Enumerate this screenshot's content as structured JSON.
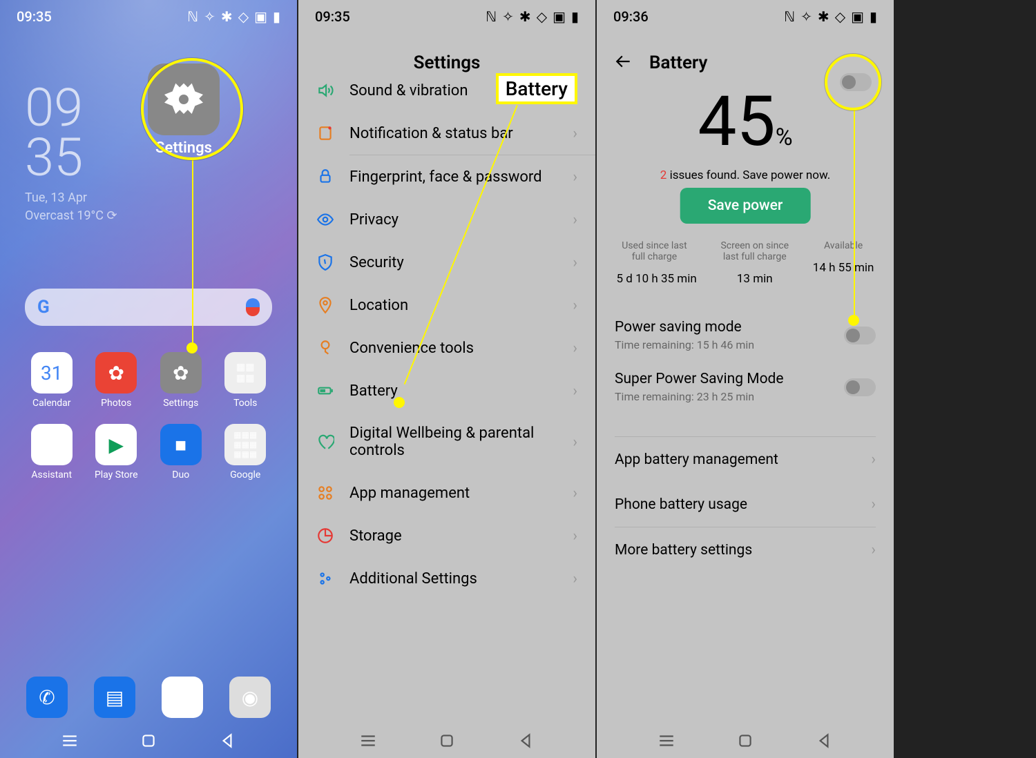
{
  "panel1": {
    "status_time": "09:35",
    "clock_hours": "09",
    "clock_mins": "35",
    "date": "Tue, 13 Apr",
    "weather": "Overcast 19°C",
    "enlarged_app_label": "Settings",
    "apps": {
      "calendar": "Calendar",
      "photos": "Photos",
      "settings": "Settings",
      "tools": "Tools",
      "assistant": "Assistant",
      "playstore": "Play Store",
      "duo": "Duo",
      "google": "Google"
    }
  },
  "panel2": {
    "status_time": "09:35",
    "header": "Settings",
    "highlight_label": "Battery",
    "items": {
      "sound": "Sound & vibration",
      "notif": "Notification & status bar",
      "fingerprint": "Fingerprint, face & password",
      "privacy": "Privacy",
      "security": "Security",
      "location": "Location",
      "convenience": "Convenience tools",
      "battery": "Battery",
      "digital": "Digital Wellbeing & parental controls",
      "appmgmt": "App management",
      "storage": "Storage",
      "additional": "Additional Settings"
    }
  },
  "panel3": {
    "status_time": "09:36",
    "header": "Battery",
    "percent": "45",
    "percent_sym": "%",
    "issues_count": "2",
    "issues_text": " issues found. Save power now.",
    "save_btn": "Save power",
    "stats": {
      "used_label": "Used since last full charge",
      "used_val": "5 d 10 h 35 min",
      "screen_label": "Screen on since last full charge",
      "screen_val": "13 min",
      "avail_label": "Available",
      "avail_val": "14 h 55 min"
    },
    "modes": {
      "power_title": "Power saving mode",
      "power_sub": "Time remaining:  15 h 46 min",
      "super_title": "Super Power Saving Mode",
      "super_sub": "Time remaining:  23 h 25 min"
    },
    "rows": {
      "app_mgmt": "App battery management",
      "phone_usage": "Phone battery usage",
      "more": "More battery settings"
    }
  }
}
